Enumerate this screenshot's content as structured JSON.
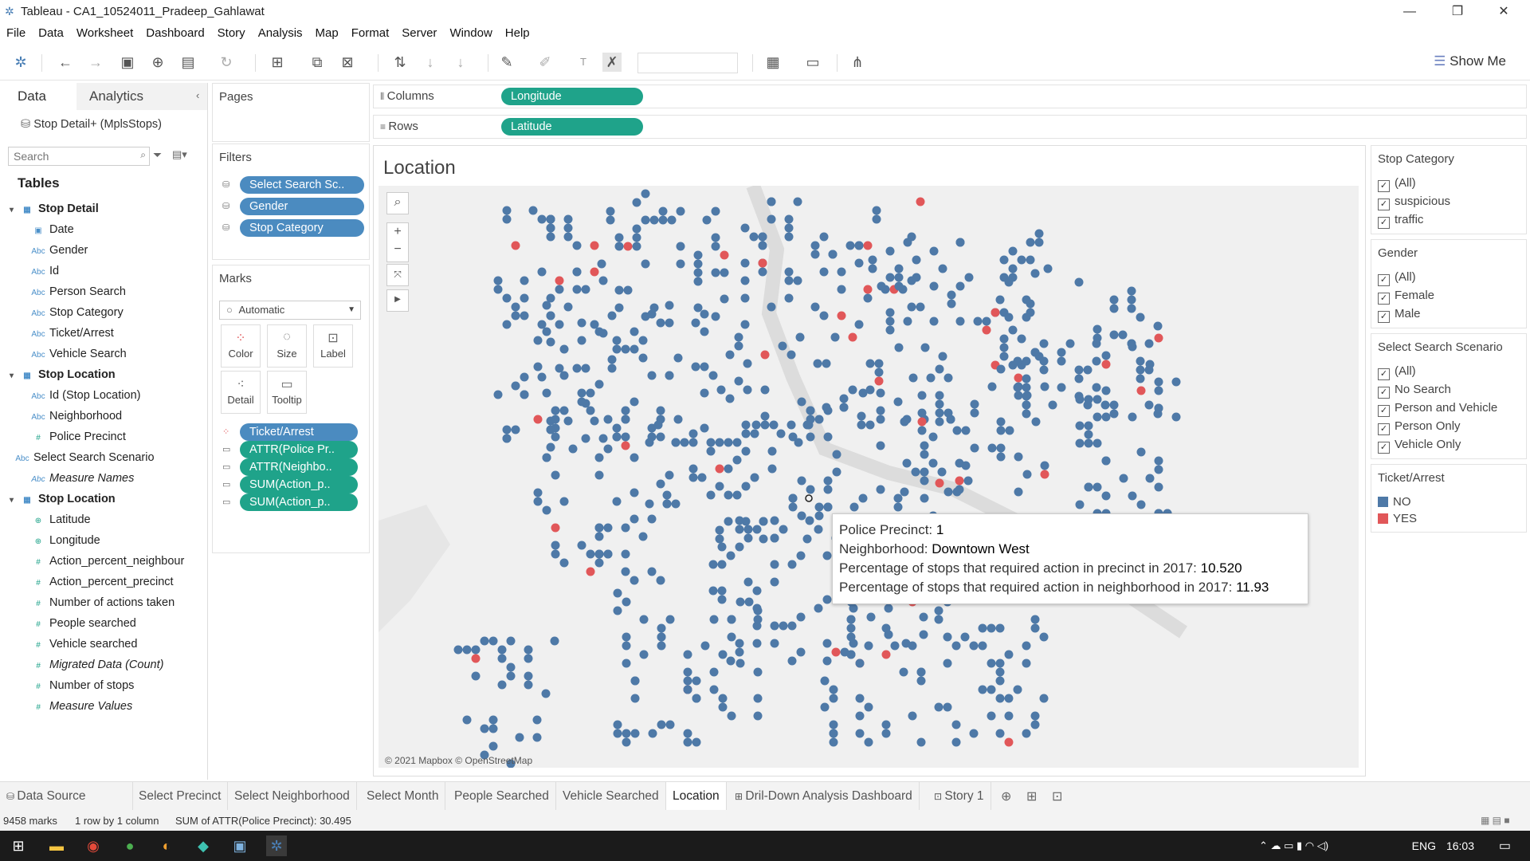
{
  "window": {
    "title": "Tableau - CA1_10524011_Pradeep_Gahlawat"
  },
  "menu": [
    "File",
    "Data",
    "Worksheet",
    "Dashboard",
    "Story",
    "Analysis",
    "Map",
    "Format",
    "Server",
    "Window",
    "Help"
  ],
  "toolbar": {
    "show_me": "Show Me"
  },
  "data_pane": {
    "tab_data": "Data",
    "tab_analytics": "Analytics",
    "datasource": "Stop Detail+ (MplsStops)",
    "search_placeholder": "Search",
    "tables_label": "Tables",
    "fields": [
      {
        "label": "Stop Detail",
        "kind": "table",
        "icon": "table-icon"
      },
      {
        "label": "Date",
        "kind": "dim",
        "icon": "calendar-icon"
      },
      {
        "label": "Gender",
        "kind": "dim",
        "icon": "abc-icon"
      },
      {
        "label": "Id",
        "kind": "dim",
        "icon": "abc-icon"
      },
      {
        "label": "Person Search",
        "kind": "dim",
        "icon": "abc-icon"
      },
      {
        "label": "Stop Category",
        "kind": "dim",
        "icon": "abc-icon"
      },
      {
        "label": "Ticket/Arrest",
        "kind": "dim",
        "icon": "abc-icon"
      },
      {
        "label": "Vehicle Search",
        "kind": "dim",
        "icon": "abc-icon"
      },
      {
        "label": "Stop Location",
        "kind": "table",
        "icon": "table-icon"
      },
      {
        "label": "Id (Stop Location)",
        "kind": "dim",
        "icon": "abc-icon"
      },
      {
        "label": "Neighborhood",
        "kind": "dim",
        "icon": "abc-icon"
      },
      {
        "label": "Police Precinct",
        "kind": "dim",
        "icon": "hash-icon"
      },
      {
        "label": "Select Search Scenario",
        "kind": "param",
        "icon": "abc-icon"
      },
      {
        "label": "Measure Names",
        "kind": "italic",
        "icon": "abc-icon"
      },
      {
        "label": "Stop Location",
        "kind": "table",
        "icon": "table-icon"
      },
      {
        "label": "Latitude",
        "kind": "geo",
        "icon": "globe-icon"
      },
      {
        "label": "Longitude",
        "kind": "geo",
        "icon": "globe-icon"
      },
      {
        "label": "Action_percent_neighbour",
        "kind": "measure",
        "icon": "hash-icon"
      },
      {
        "label": "Action_percent_precinct",
        "kind": "measure",
        "icon": "hash-icon"
      },
      {
        "label": "Number of actions taken",
        "kind": "measure",
        "icon": "hash-icon"
      },
      {
        "label": "People searched",
        "kind": "measure",
        "icon": "hash-icon"
      },
      {
        "label": "Vehicle searched",
        "kind": "measure",
        "icon": "hash-icon"
      },
      {
        "label": "Migrated Data (Count)",
        "kind": "measure-italic",
        "icon": "hash-icon"
      },
      {
        "label": "Number of stops",
        "kind": "measure",
        "icon": "hash-icon"
      },
      {
        "label": "Measure Values",
        "kind": "measure-italic",
        "icon": "hash-icon"
      }
    ]
  },
  "pages": {
    "label": "Pages"
  },
  "filters": {
    "label": "Filters",
    "items": [
      "Select Search Sc..",
      "Gender",
      "Stop Category"
    ]
  },
  "marks": {
    "label": "Marks",
    "type": "Automatic",
    "buttons": [
      "Color",
      "Size",
      "Label",
      "Detail",
      "Tooltip"
    ],
    "pills": [
      {
        "text": "Ticket/Arrest",
        "color": "blue",
        "icon": "color-icon"
      },
      {
        "text": "ATTR(Police Pr..",
        "color": "green",
        "icon": "tooltip-icon"
      },
      {
        "text": "ATTR(Neighbo..",
        "color": "green",
        "icon": "tooltip-icon"
      },
      {
        "text": "SUM(Action_p..",
        "color": "green",
        "icon": "tooltip-icon"
      },
      {
        "text": "SUM(Action_p..",
        "color": "green",
        "icon": "tooltip-icon"
      }
    ]
  },
  "columns": {
    "label": "Columns",
    "pill": "Longitude"
  },
  "rows": {
    "label": "Rows",
    "pill": "Latitude"
  },
  "viz": {
    "title": "Location",
    "attribution": "© 2021 Mapbox © OpenStreetMap",
    "tooltip": {
      "l1_label": "Police Precinct:",
      "l1_value": "1",
      "l2_label": "Neighborhood:",
      "l2_value": "Downtown West",
      "l3_label": "Percentage of stops that required action in precinct in 2017:",
      "l3_value": "10.520",
      "l4_label": "Percentage of stops that required action in neighborhood in 2017:",
      "l4_value": "11.93"
    }
  },
  "legends": {
    "stop_category": {
      "title": "Stop Category",
      "items": [
        "(All)",
        "suspicious",
        "traffic"
      ]
    },
    "gender": {
      "title": "Gender",
      "items": [
        "(All)",
        "Female",
        "Male"
      ]
    },
    "scenario": {
      "title": "Select Search Scenario",
      "items": [
        "(All)",
        "No Search",
        "Person and Vehicle",
        "Person Only",
        "Vehicle Only"
      ]
    },
    "ticket": {
      "title": "Ticket/Arrest",
      "items": [
        {
          "label": "NO",
          "color": "#4e79a7"
        },
        {
          "label": "YES",
          "color": "#e15759"
        }
      ]
    }
  },
  "sheet_tabs": [
    "Data Source",
    "Select Precinct",
    "Select Neighborhood",
    "Select Month",
    "People Searched",
    "Vehicle Searched",
    "Location",
    "Dril-Down Analysis Dashboard",
    "Story 1"
  ],
  "active_tab": "Location",
  "status": {
    "marks": "9458 marks",
    "grid": "1 row by 1 column",
    "sum": "SUM of ATTR(Police Precinct): 30.495"
  },
  "taskbar": {
    "lang": "ENG",
    "time": "16:03"
  },
  "colors": {
    "mark_no": "#4e79a7",
    "mark_yes": "#e15759",
    "pill_blue": "#4b8bc0",
    "pill_green": "#1fa38a"
  }
}
